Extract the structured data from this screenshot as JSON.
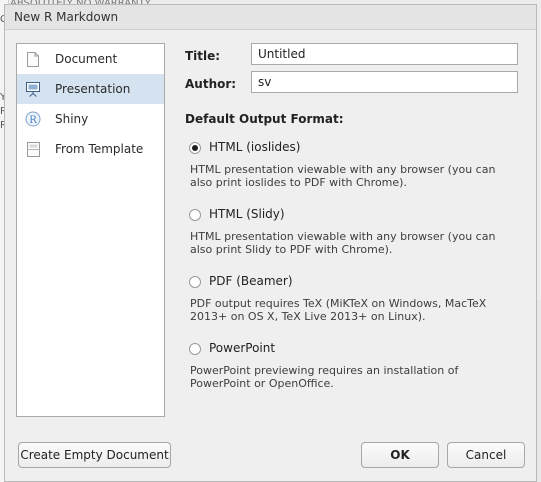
{
  "background": {
    "top_text": "ABSOLUTELY NO WARRANTY",
    "edge_chars": [
      "C",
      "Y",
      "R",
      "R"
    ]
  },
  "dialog": {
    "title": "New R Markdown"
  },
  "sidebar": {
    "items": [
      {
        "label": "Document",
        "icon": "document-icon",
        "selected": false
      },
      {
        "label": "Presentation",
        "icon": "presentation-icon",
        "selected": true
      },
      {
        "label": "Shiny",
        "icon": "shiny-icon",
        "selected": false
      },
      {
        "label": "From Template",
        "icon": "template-icon",
        "selected": false
      }
    ]
  },
  "form": {
    "title_label": "Title:",
    "title_value": "Untitled",
    "author_label": "Author:",
    "author_value": "sv"
  },
  "output": {
    "heading": "Default Output Format:",
    "options": [
      {
        "label": "HTML (ioslides)",
        "checked": true,
        "description": "HTML presentation viewable with any browser (you can also print ioslides to PDF with Chrome)."
      },
      {
        "label": "HTML (Slidy)",
        "checked": false,
        "description": "HTML presentation viewable with any browser (you can also print Slidy to PDF with Chrome)."
      },
      {
        "label": "PDF (Beamer)",
        "checked": false,
        "description": "PDF output requires TeX (MiKTeX on Windows, MacTeX 2013+ on OS X, TeX Live 2013+ on Linux)."
      },
      {
        "label": "PowerPoint",
        "checked": false,
        "description": "PowerPoint previewing requires an installation of PowerPoint or OpenOffice."
      }
    ]
  },
  "buttons": {
    "create_empty": "Create Empty Document",
    "ok": "OK",
    "cancel": "Cancel"
  },
  "colors": {
    "selected_row": "#d5e3f1",
    "shiny_accent": "#4a7fbf"
  }
}
